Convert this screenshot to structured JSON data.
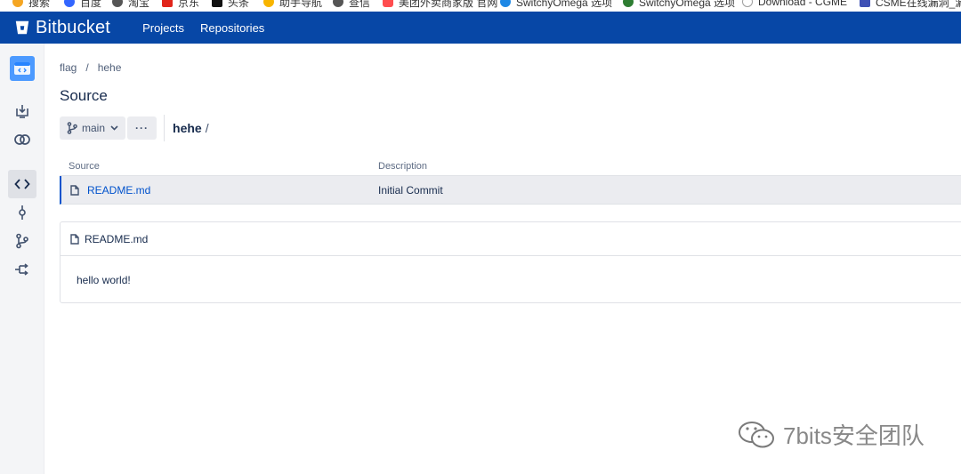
{
  "bookmarks": [
    {
      "label": "搜索",
      "color": "#f5a623"
    },
    {
      "label": "百度",
      "color": "#3366ff"
    },
    {
      "label": "淘宝",
      "color": "#555555"
    },
    {
      "label": "京东",
      "color": "#e1251b"
    },
    {
      "label": "头条",
      "color": "#111111"
    },
    {
      "label": "助手导航",
      "color": "#f8b500"
    },
    {
      "label": "查信",
      "color": "#555555"
    },
    {
      "label": "美团外卖商家版 官网",
      "color": "#ff4d4f"
    },
    {
      "label": "SwitchyOmega 选项",
      "color": "#1e88e5"
    },
    {
      "label": "SwitchyOmega 选项",
      "color": "#2e7d32"
    },
    {
      "label": "Download - CGME",
      "color": "#9e9e9e"
    },
    {
      "label": "CSME在线漏洞_漏",
      "color": "#3f51b5"
    }
  ],
  "topbar": {
    "brand": "Bitbucket",
    "nav": [
      "Projects",
      "Repositories"
    ],
    "background": "#0747a6"
  },
  "sidebar": {
    "icons": [
      "repo-avatar-icon",
      "clone-icon",
      "compare-icon",
      "source-icon",
      "commits-icon",
      "branches-icon",
      "pull-requests-icon"
    ],
    "active": "source-icon"
  },
  "breadcrumb": [
    "flag",
    "/",
    "hehe"
  ],
  "page": {
    "title": "Source"
  },
  "toolbar": {
    "branch": "main",
    "more": "···",
    "path_repo": "hehe",
    "path_sep": "/"
  },
  "table": {
    "headers": {
      "source": "Source",
      "description": "Description"
    },
    "rows": [
      {
        "name": "README.md",
        "description": "Initial Commit"
      }
    ]
  },
  "readme": {
    "filename": "README.md",
    "content": "hello world!"
  },
  "watermark": {
    "text": "7bits安全团队"
  }
}
